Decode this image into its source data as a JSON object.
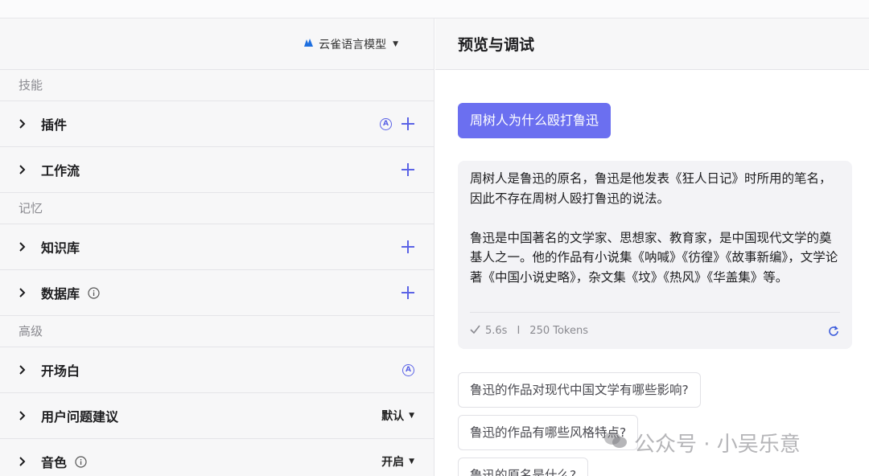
{
  "left": {
    "model_name": "云雀语言模型",
    "sections": [
      {
        "title": "技能",
        "items": [
          {
            "label": "插件"
          },
          {
            "label": "工作流"
          }
        ]
      },
      {
        "title": "记忆",
        "items": [
          {
            "label": "知识库"
          },
          {
            "label": "数据库"
          }
        ]
      },
      {
        "title": "高级",
        "items": [
          {
            "label": "开场白"
          },
          {
            "label": "用户问题建议",
            "value": "默认"
          },
          {
            "label": "音色",
            "value": "开启"
          }
        ]
      }
    ],
    "auto_badge": "A"
  },
  "right": {
    "title": "预览与调试",
    "user_message": "周树人为什么殴打鲁迅",
    "bot_paragraph_1": "周树人是鲁迅的原名，鲁迅是他发表《狂人日记》时所用的笔名，因此不存在周树人殴打鲁迅的说法。",
    "bot_paragraph_2": "鲁迅是中国著名的文学家、思想家、教育家，是中国现代文学的奠基人之一。他的作品有小说集《呐喊》《彷徨》《故事新编》，文学论著《中国小说史略》，杂文集《坟》《热风》《华盖集》等。",
    "meta_time": "5.6s",
    "meta_sep": "I",
    "meta_tokens": "250 Tokens",
    "suggestions": [
      "鲁迅的作品对现代中国文学有哪些影响?",
      "鲁迅的作品有哪些风格特点?",
      "鲁迅的原名是什么?"
    ]
  },
  "watermark": "公众号 · 小吴乐意",
  "colors": {
    "accent": "#5b63e6",
    "user_bubble": "#6b6ff0",
    "panel_bg": "#f7f7f8"
  }
}
